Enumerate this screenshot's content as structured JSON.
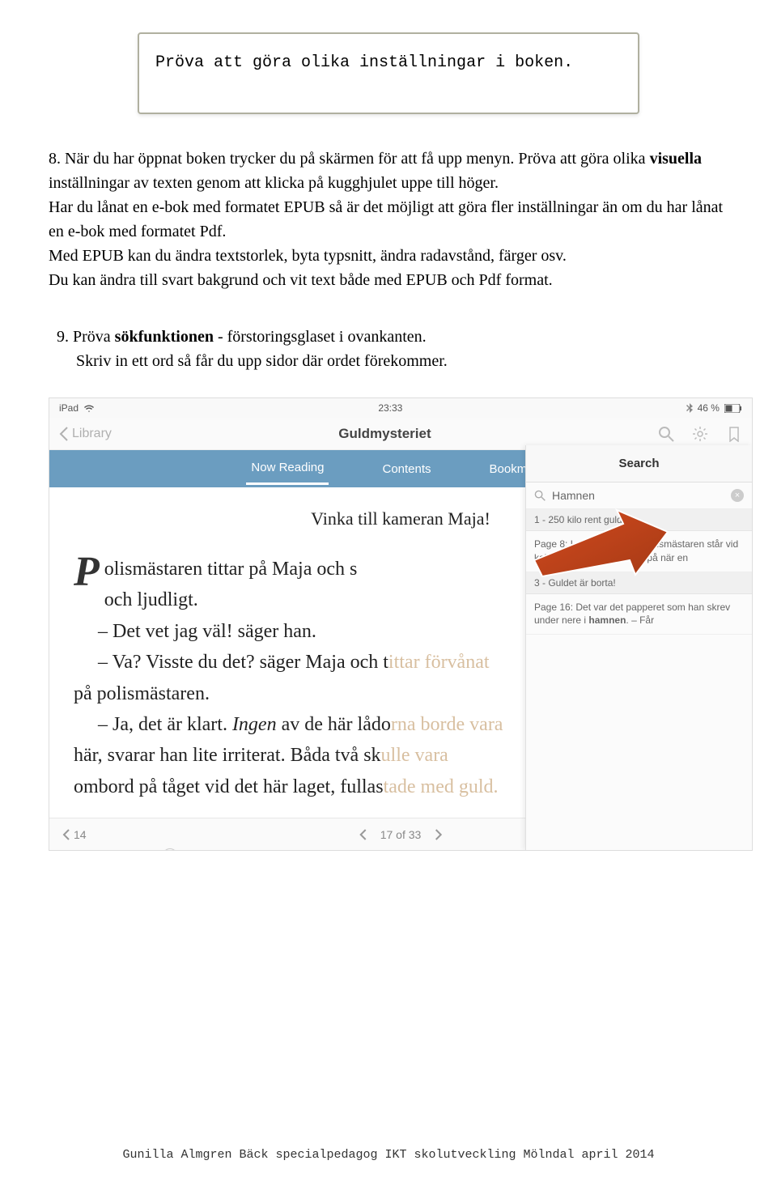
{
  "callout": {
    "text": "Pröva att göra olika inställningar i boken."
  },
  "step8": {
    "p1_prefix": "8. När du har öppnat boken trycker du på skärmen för att få upp menyn. Pröva att göra olika ",
    "p1_bold": "visuella",
    "p1_rest": " inställningar av texten genom att klicka på kugghjulet uppe till höger.",
    "p2": "Har du lånat en e-bok med formatet EPUB så är det möjligt att göra fler inställningar än om du har lånat en e-bok med formatet Pdf.",
    "p3": "Med EPUB kan du ändra textstorlek, byta typsnitt, ändra radavstånd, färger osv.",
    "p4": "Du kan ändra till svart bakgrund och vit text både med EPUB och Pdf format."
  },
  "step9": {
    "l1_prefix": "9.  Pröva ",
    "l1_bold": "sökfunktionen",
    "l1_rest": " - förstoringsglaset i ovankanten.",
    "l2": "Skriv in ett ord så får du upp sidor där ordet förekommer."
  },
  "screenshot": {
    "status": {
      "ipad": "iPad",
      "time": "23:33",
      "battery": "46 %"
    },
    "nav": {
      "back": "Library",
      "title": "Guldmysteriet"
    },
    "tabs": {
      "t1": "Now Reading",
      "t2": "Contents",
      "t3": "Bookmarks"
    },
    "search": {
      "header": "Search",
      "query": "Hamnen",
      "sec1": "1 - 250 kilo rent guld",
      "res1_a": "Page 8: Lasse, Maja och polismästaren står vid kajen i ",
      "res1_b": "hamnen",
      "res1_c": ". Det tittar på när en",
      "sec2": "3 - Guldet är borta!",
      "res2_a": "Page 16: Det var det papperet som han skrev under nere i ",
      "res2_b": "hamnen",
      "res2_c": ".               – Får"
    },
    "chapter_title": "Vinka till kameran Maja!",
    "book": {
      "drop": "P",
      "line1": "olismästaren tittar på Maja och s",
      "line_ghost1_rest": "",
      "line2": "och ljudligt.",
      "line3": "– Det vet jag väl! säger han.",
      "line4_a": "– Va? Visste du det? säger Maja och t",
      "line4_ghost": "ittar förvånat",
      "line5": "på polismästaren.",
      "line6_a": "– Ja, det är klart. ",
      "line6_em": "Ingen",
      "line6_b": " av de här lådo",
      "line6_ghost": "rna borde vara",
      "line7_a": "här, svarar han lite irriterat. Båda två sk",
      "line7_ghost": "ulle vara",
      "line8_a": "ombord på tåget vid det här laget, fullas",
      "line8_ghost": "tade med guld."
    },
    "pager": {
      "prev": "14",
      "of": "17 of 33"
    }
  },
  "footer": "Gunilla Almgren Bäck  specialpedagog  IKT skolutveckling   Mölndal april 2014"
}
